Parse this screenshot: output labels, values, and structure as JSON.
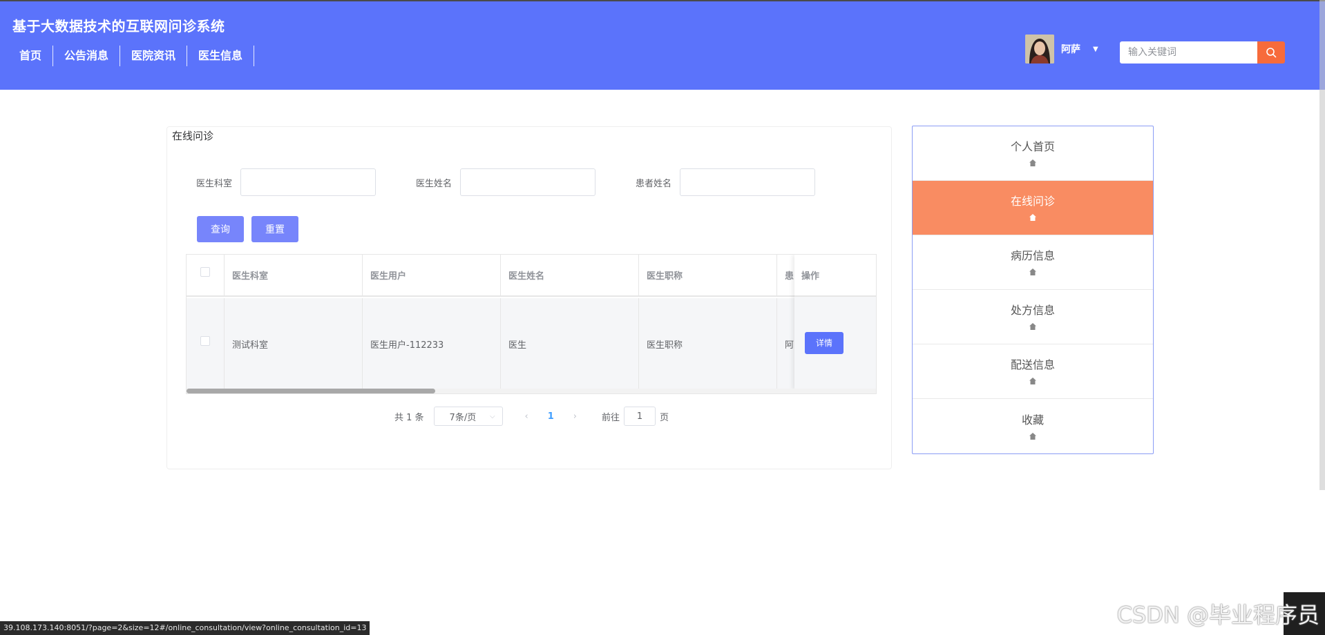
{
  "header": {
    "site_title": "基于大数据技术的互联网问诊系统",
    "nav": [
      "首页",
      "公告消息",
      "医院资讯",
      "医生信息"
    ],
    "user_name": "阿萨",
    "search_placeholder": "输入关键词"
  },
  "panel": {
    "title": "在线问诊",
    "filters": [
      {
        "label": "医生科室",
        "value": ""
      },
      {
        "label": "医生姓名",
        "value": ""
      },
      {
        "label": "患者姓名",
        "value": ""
      }
    ],
    "buttons": {
      "query": "查询",
      "reset": "重置"
    }
  },
  "table": {
    "headers": [
      "医生科室",
      "医生用户",
      "医生姓名",
      "医生职称",
      "患",
      "操作"
    ],
    "rows": [
      {
        "dept": "测试科室",
        "user": "医生用户-112233",
        "name": "医生",
        "title": "医生职称",
        "patient": "阿",
        "action": "详情"
      }
    ]
  },
  "pagination": {
    "total": "共 1 条",
    "page_size": "7条/页",
    "current_page": "1",
    "goto_label": "前往",
    "goto_value": "1",
    "page_suffix": "页"
  },
  "side_menu": {
    "items": [
      {
        "label": "个人首页",
        "icon": "home-icon"
      },
      {
        "label": "在线问诊",
        "icon": "home-icon",
        "active": true
      },
      {
        "label": "病历信息",
        "icon": "home-icon"
      },
      {
        "label": "处方信息",
        "icon": "home-icon"
      },
      {
        "label": "配送信息",
        "icon": "home-icon"
      },
      {
        "label": "收藏",
        "icon": "home-icon"
      }
    ]
  },
  "status_bar": {
    "url": "39.108.173.140:8051/?page=2&size=12#/online_consultation/view?online_consultation_id=13"
  },
  "watermark": "CSDN @毕业程序员",
  "colors": {
    "header_bg": "#5b73fb",
    "button": "#7785fb",
    "active_menu": "#f98c62",
    "search_button": "#f76b3b"
  }
}
